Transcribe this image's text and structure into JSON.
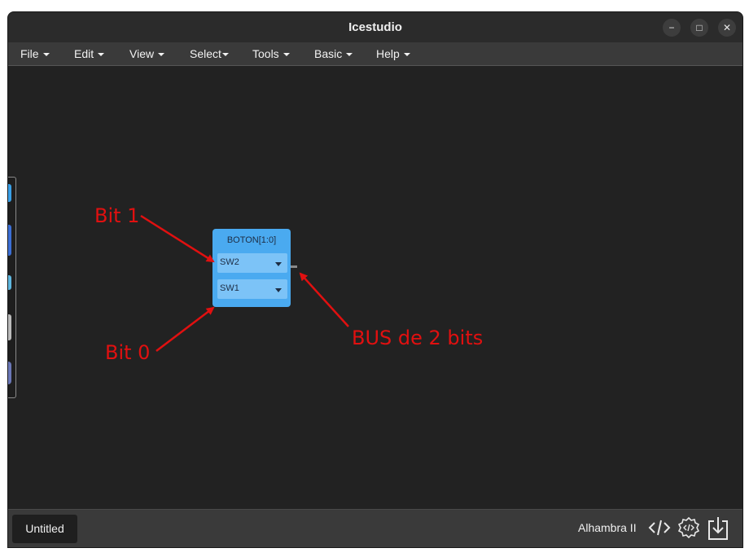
{
  "window": {
    "title": "Icestudio",
    "controls": {
      "minimize": "−",
      "maximize": "□",
      "close": "✕"
    }
  },
  "menu": {
    "items": [
      "File",
      "Edit",
      "View",
      "Select",
      "Tools",
      "Basic",
      "Help"
    ]
  },
  "canvas": {
    "block": {
      "title": "BOTON[1:0]",
      "pins": [
        "SW2",
        "SW1"
      ]
    },
    "annotations": {
      "bit1": "Bit 1",
      "bit0": "Bit 0",
      "bus": "BUS de 2 bits",
      "color": "#e11010"
    },
    "block_color": "#4aaaf0"
  },
  "footer": {
    "tab": "Untitled",
    "board": "Alhambra II",
    "icons": [
      "code-icon",
      "verify-icon",
      "upload-icon"
    ]
  }
}
